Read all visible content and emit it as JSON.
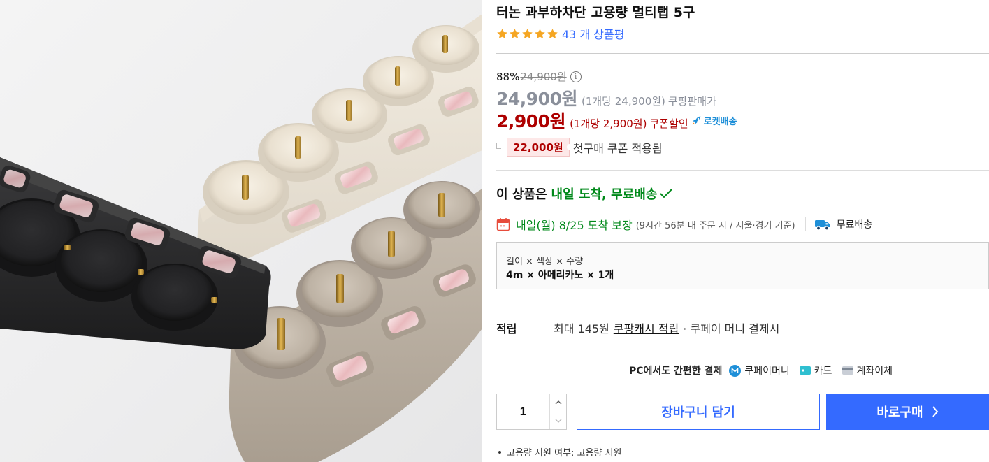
{
  "product": {
    "title": "터논 과부하차단 고용량 멀티탭 5구",
    "image_name": "멀티탭 제품 사진"
  },
  "rating": {
    "stars": 5,
    "review_count_text": "43 개 상품평"
  },
  "pricing": {
    "discount_rate": "88%",
    "original_price": "24,900원",
    "sale_price": "24,900원",
    "sale_unit": "(1개당 24,900원)",
    "sale_type": "쿠팡판매가",
    "coupon_price": "2,900원",
    "coupon_unit": "(1개당 2,900원)",
    "coupon_type": "쿠폰할인",
    "rocket_label": "로켓배송",
    "first_coupon_amount": "22,000원",
    "first_coupon_text": "첫구매 쿠폰 적용됨"
  },
  "delivery": {
    "headline_prefix": "이 상품은",
    "headline_highlight": "내일 도착, 무료배송",
    "arrival_main": "내일(월) 8/25 도착 보장",
    "arrival_sub": "(9시간 56분 내 주문 시 / 서울·경기 기준)",
    "free_shipping": "무료배송"
  },
  "option": {
    "label": "길이 × 색상 × 수량",
    "value": "4m × 아메리카노 × 1개"
  },
  "cashback": {
    "label": "적립",
    "text": "최대 145원",
    "link": "쿠팡캐시 적립",
    "tail": "· 쿠페이 머니 결제시"
  },
  "payment": {
    "title": "PC에서도 간편한 결제",
    "methods": [
      "쿠페이머니",
      "카드",
      "계좌이체"
    ]
  },
  "purchase": {
    "quantity": "1",
    "cart_label": "장바구니 담기",
    "buy_label": "바로구매"
  },
  "attributes": [
    "고용량 지원 여부: 고용량 지원"
  ],
  "colors": {
    "accent_blue": "#346aff",
    "coupon_red": "#ae0000",
    "delivery_green": "#00891a",
    "star_orange": "#f5a623"
  }
}
